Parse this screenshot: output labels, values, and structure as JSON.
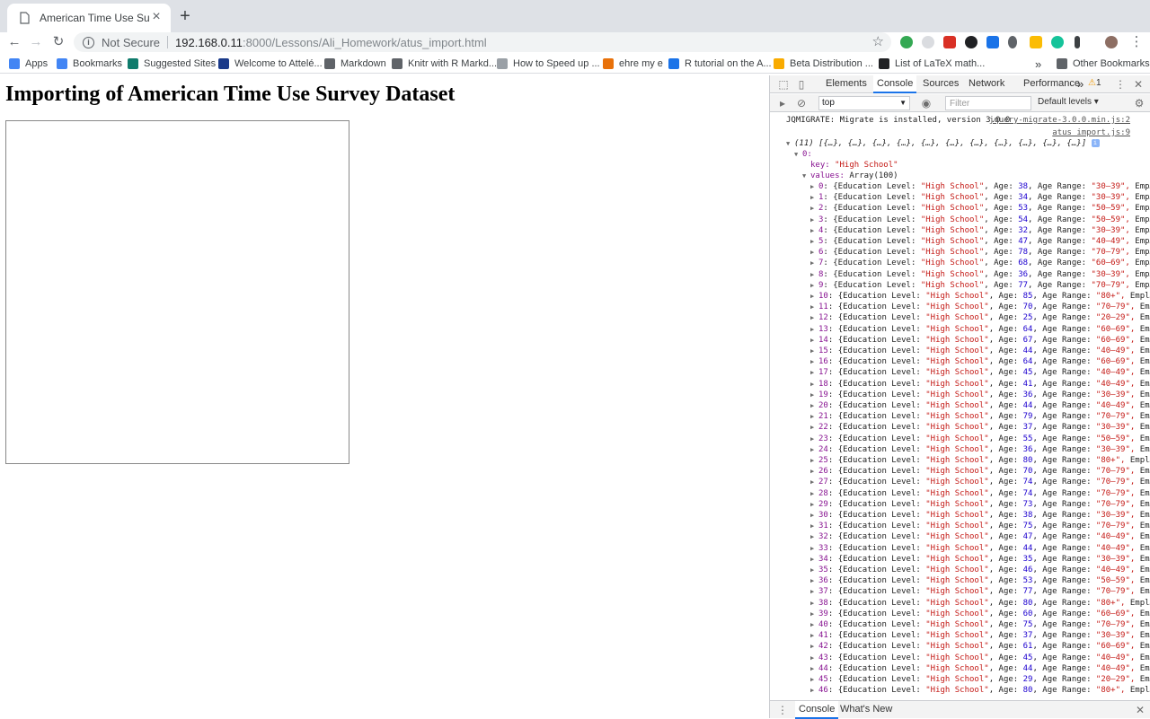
{
  "tab": {
    "title": "American Time Use Survey - Import",
    "new_tab": "+",
    "close": "×"
  },
  "toolbar": {
    "not_secure": "Not Secure",
    "url_host": "192.168.0.11",
    "url_path": ":8000/Lessons/Ali_Homework/atus_import.html"
  },
  "bookmarks": [
    {
      "label": "Apps",
      "color": "#4285f4"
    },
    {
      "label": "Bookmarks",
      "color": "#4285f4"
    },
    {
      "label": "Suggested Sites",
      "color": "#0f7b6c"
    },
    {
      "label": "Welcome to Attelé...",
      "color": "#1a3a8a"
    },
    {
      "label": "Markdown",
      "color": "#5f6368"
    },
    {
      "label": "Knitr with R Markd...",
      "color": "#5f6368"
    },
    {
      "label": "How to Speed up ...",
      "color": "#9aa0a6"
    },
    {
      "label": "ehre my e",
      "color": "#e8710a"
    },
    {
      "label": "R tutorial on the A...",
      "color": "#1a73e8"
    },
    {
      "label": "Beta Distribution ...",
      "color": "#f9ab00"
    },
    {
      "label": "List of LaTeX math...",
      "color": "#202124"
    },
    {
      "label": "»",
      "color": ""
    },
    {
      "label": "Other Bookmarks",
      "color": "#5f6368"
    }
  ],
  "page": {
    "title": "Importing of American Time Use Survey Dataset"
  },
  "devtools": {
    "tabs": [
      "Elements",
      "Console",
      "Sources",
      "Network",
      "Performance"
    ],
    "more": "»",
    "warnings": "1",
    "context": "top",
    "filter_placeholder": "Filter",
    "levels": "Default levels ▾",
    "drawer_tabs": [
      "Console",
      "What's New"
    ],
    "console": {
      "jqmigrate": "JQMIGRATE: Migrate is installed, version 3.0.0",
      "jqmigrate_src": "jquery-migrate-3.0.0.min.js:2",
      "log_src": "atus_import.js:9",
      "array_summary": "(11) [{…}, {…}, {…}, {…}, {…}, {…}, {…}, {…}, {…}, {…}, {…}]",
      "index0": "0:",
      "key_label": "key: ",
      "key_value": "\"High School\"",
      "values_label": "values: ",
      "values_value": "Array(100)",
      "rows": [
        {
          "i": 0,
          "age": 38,
          "range": "30–39",
          "tail": "Emp…"
        },
        {
          "i": 1,
          "age": 34,
          "range": "30–39",
          "tail": "Emp…"
        },
        {
          "i": 2,
          "age": 53,
          "range": "50–59",
          "tail": "Emp…"
        },
        {
          "i": 3,
          "age": 54,
          "range": "50–59",
          "tail": "Emp…"
        },
        {
          "i": 4,
          "age": 32,
          "range": "30–39",
          "tail": "Emp…"
        },
        {
          "i": 5,
          "age": 47,
          "range": "40–49",
          "tail": "Emp…"
        },
        {
          "i": 6,
          "age": 78,
          "range": "70–79",
          "tail": "Emp…"
        },
        {
          "i": 7,
          "age": 68,
          "range": "60–69",
          "tail": "Emp…"
        },
        {
          "i": 8,
          "age": 36,
          "range": "30–39",
          "tail": "Emp…"
        },
        {
          "i": 9,
          "age": 77,
          "range": "70–79",
          "tail": "Emp…"
        },
        {
          "i": 10,
          "age": 85,
          "range": "80+",
          "tail": "Empl…"
        },
        {
          "i": 11,
          "age": 70,
          "range": "70–79",
          "tail": "Em…"
        },
        {
          "i": 12,
          "age": 25,
          "range": "20–29",
          "tail": "Em…"
        },
        {
          "i": 13,
          "age": 64,
          "range": "60–69",
          "tail": "Em…"
        },
        {
          "i": 14,
          "age": 67,
          "range": "60–69",
          "tail": "Em…"
        },
        {
          "i": 15,
          "age": 44,
          "range": "40–49",
          "tail": "Em…"
        },
        {
          "i": 16,
          "age": 64,
          "range": "60–69",
          "tail": "Em…"
        },
        {
          "i": 17,
          "age": 45,
          "range": "40–49",
          "tail": "Em…"
        },
        {
          "i": 18,
          "age": 41,
          "range": "40–49",
          "tail": "Em…"
        },
        {
          "i": 19,
          "age": 36,
          "range": "30–39",
          "tail": "Em…"
        },
        {
          "i": 20,
          "age": 44,
          "range": "40–49",
          "tail": "Em…"
        },
        {
          "i": 21,
          "age": 79,
          "range": "70–79",
          "tail": "Em…"
        },
        {
          "i": 22,
          "age": 37,
          "range": "30–39",
          "tail": "Em…"
        },
        {
          "i": 23,
          "age": 55,
          "range": "50–59",
          "tail": "Em…"
        },
        {
          "i": 24,
          "age": 36,
          "range": "30–39",
          "tail": "Em…"
        },
        {
          "i": 25,
          "age": 80,
          "range": "80+",
          "tail": "Empl…"
        },
        {
          "i": 26,
          "age": 70,
          "range": "70–79",
          "tail": "Em…"
        },
        {
          "i": 27,
          "age": 74,
          "range": "70–79",
          "tail": "Em…"
        },
        {
          "i": 28,
          "age": 74,
          "range": "70–79",
          "tail": "Em…"
        },
        {
          "i": 29,
          "age": 73,
          "range": "70–79",
          "tail": "Em…"
        },
        {
          "i": 30,
          "age": 38,
          "range": "30–39",
          "tail": "Em…"
        },
        {
          "i": 31,
          "age": 75,
          "range": "70–79",
          "tail": "Em…"
        },
        {
          "i": 32,
          "age": 47,
          "range": "40–49",
          "tail": "Em…"
        },
        {
          "i": 33,
          "age": 44,
          "range": "40–49",
          "tail": "Em…"
        },
        {
          "i": 34,
          "age": 35,
          "range": "30–39",
          "tail": "Em…"
        },
        {
          "i": 35,
          "age": 46,
          "range": "40–49",
          "tail": "Em…"
        },
        {
          "i": 36,
          "age": 53,
          "range": "50–59",
          "tail": "Em…"
        },
        {
          "i": 37,
          "age": 77,
          "range": "70–79",
          "tail": "Em…"
        },
        {
          "i": 38,
          "age": 80,
          "range": "80+",
          "tail": "Empl…"
        },
        {
          "i": 39,
          "age": 60,
          "range": "60–69",
          "tail": "Em…"
        },
        {
          "i": 40,
          "age": 75,
          "range": "70–79",
          "tail": "Em…"
        },
        {
          "i": 41,
          "age": 37,
          "range": "30–39",
          "tail": "Em…"
        },
        {
          "i": 42,
          "age": 61,
          "range": "60–69",
          "tail": "Em…"
        },
        {
          "i": 43,
          "age": 45,
          "range": "40–49",
          "tail": "Em…"
        },
        {
          "i": 44,
          "age": 44,
          "range": "40–49",
          "tail": "Em…"
        },
        {
          "i": 45,
          "age": 29,
          "range": "20–29",
          "tail": "Em…"
        },
        {
          "i": 46,
          "age": 80,
          "range": "80+",
          "tail": "Empl…"
        }
      ],
      "row_prefix": "{Education Level: ",
      "row_level": "\"High School\"",
      "row_age_label": ", Age: ",
      "row_range_label": ", Age Range: "
    }
  }
}
